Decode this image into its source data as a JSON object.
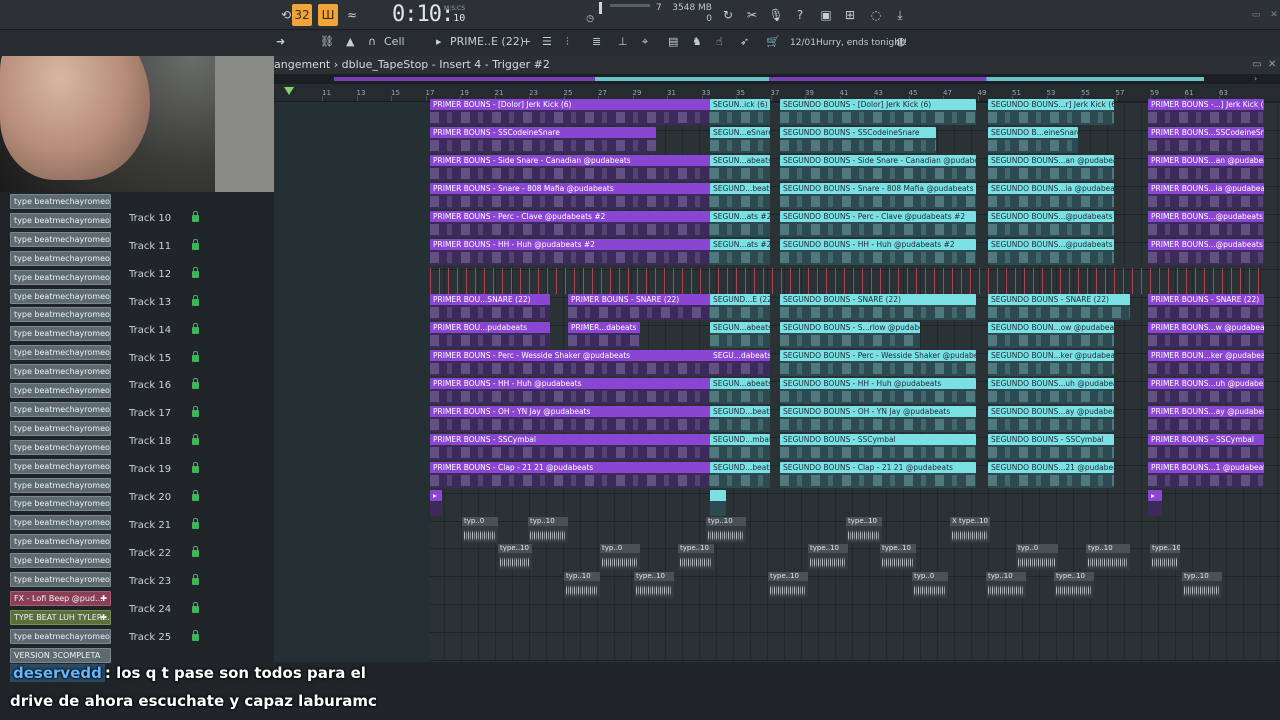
{
  "toolbar": {
    "pattern_btn": "32",
    "song_btn": "Ш",
    "timer_main": "0:10:",
    "timer_sub": "10",
    "timer_unit": "M:S:CS",
    "pitch": "7",
    "mem": "3548 MB",
    "cpu_small": "0"
  },
  "toolbar2": {
    "snap": "Cell",
    "pattern": "PRIME..E (22)",
    "promo_date": "12/01",
    "promo_text": "Hurry, ends tonight!"
  },
  "playlist": {
    "title": "angement › dblue_TapeStop - Insert 4 - Trigger #2",
    "bars": [
      "11",
      "13",
      "15",
      "17",
      "19",
      "21",
      "23",
      "25",
      "27",
      "29",
      "31",
      "33",
      "35",
      "37",
      "39",
      "41",
      "43",
      "45",
      "47",
      "49",
      "51",
      "53",
      "55",
      "57",
      "59",
      "61",
      "63"
    ]
  },
  "channels": [
    "type beatmechayromeo_...",
    "type beatmechayromeo_...",
    "type beatmechayromeo_...",
    "type beatmechayromeo_...",
    "type beatmechayromeo_...",
    "type beatmechayromeo_...",
    "type beatmechayromeo_...",
    "type beatmechayromeo_...",
    "type beatmechayromeo_...",
    "type beatmechayromeo_...",
    "type beatmechayromeo_...",
    "type beatmechayromeo_...",
    "type beatmechayromeo_...",
    "type beatmechayromeo_...",
    "type beatmechayromeo_...",
    "type beatmechayromeo_...",
    "type beatmechayromeo_...",
    "type beatmechayromeo_...",
    "type beatmechayromeo_...",
    "type beatmechayromeo_...",
    "type beatmechayromeo_...",
    "FX - Lofi Beep @pud...",
    "TYPE BEAT LUH TYLER...",
    "type beatmechayromeo_...",
    "VERSION 3COMPLETA"
  ],
  "tracks": [
    "Track 10",
    "Track 11",
    "Track 12",
    "Track 13",
    "Track 14",
    "Track 15",
    "Track 16",
    "Track 17",
    "Track 18",
    "Track 19",
    "Track 20",
    "Track 21",
    "Track 22",
    "Track 23",
    "Track 24",
    "Track 25"
  ],
  "clips": {
    "row0": [
      "PRIMER BOUNS - [Dolor] Jerk Kick (6)",
      "SEGUN..ick (6)",
      "SEGUNDO BOUNS - [Dolor] Jerk Kick (6)",
      "SEGUNDO BOUNS...r] Jerk Kick (6)",
      "PRIMER BOUNS -...] Jerk Kick (6)"
    ],
    "row1": [
      "PRIMER BOUNS - SSCodeineSnare",
      "SEGUN...eSnare",
      "SEGUNDO BOUNS - SSCodeineSnare",
      "SEGUNDO B...eineSnare",
      "PRIMER BOUNS...SSCodeineSnare"
    ],
    "row2": [
      "PRIMER BOUNS - Side Snare - Canadian @pudabeats",
      "SEGUN...abeats",
      "SEGUNDO BOUNS - Side Snare - Canadian @pudabeats",
      "SEGUNDO BOUNS...an @pudabeats",
      "PRIMER BOUNS...an @pudabeats"
    ],
    "row3": [
      "PRIMER BOUNS - Snare - 808 Mafia @pudabeats",
      "SEGUND...beats",
      "SEGUNDO BOUNS - Snare - 808 Mafia @pudabeats",
      "SEGUNDO BOUNS...ia @pudabeats",
      "PRIMER BOUNS...ia @pudabeats"
    ],
    "row4": [
      "PRIMER BOUNS - Perc - Clave @pudabeats #2",
      "SEGUN...ats #2",
      "SEGUNDO BOUNS - Perc - Clave @pudabeats #2",
      "SEGUNDO BOUNS...@pudabeats #2",
      "PRIMER BOUNS...@pudabeats #2"
    ],
    "row5": [
      "PRIMER BOUNS - HH - Huh @pudabeats #2",
      "SEGUN...ats #2",
      "SEGUNDO BOUNS - HH - Huh @pudabeats #2",
      "SEGUNDO BOUNS...@pudabeats #2",
      "PRIMER BOUNS...@pudabeats #2"
    ],
    "row7": [
      "PRIMER BOU...SNARE (22)",
      "PRIMER BOUNS - SNARE (22)",
      "SEGUND...E (22)",
      "SEGUNDO BOUNS - SNARE (22)",
      "SEGUNDO BOUNS - SNARE (22)",
      "PRIMER BOUNS - SNARE (22)"
    ],
    "row8": [
      "PRIMER BOU...pudabeats",
      "PRIMER...dabeats",
      "SEGUN...abeats",
      "SEGUNDO BOUNS - S...rlow @pudabeats",
      "SEGUNDO BOUN...ow @pudabeats",
      "PRIMER BOUNS...w @pudabeats"
    ],
    "row9": [
      "PRIMER BOUNS - Perc - Wesside Shaker @pudabeats",
      "SEGU...dabeats",
      "SEGUNDO BOUNS - Perc - Wesside Shaker @pudabeats",
      "SEGUNDO BOUN...ker @pudabeats",
      "PRIMER BOUN...ker @pudabeats"
    ],
    "row10": [
      "PRIMER BOUNS - HH - Huh @pudabeats",
      "SEGUN...abeats",
      "SEGUNDO BOUNS - HH - Huh @pudabeats",
      "SEGUNDO BOUNS...uh @pudabeats",
      "PRIMER BOUNS...uh @pudabeats"
    ],
    "row11": [
      "PRIMER BOUNS - OH - YN Jay @pudabeats",
      "SEGUND...beats",
      "SEGUNDO BOUNS - OH - YN Jay @pudabeats",
      "SEGUNDO BOUNS...ay @pudabeats",
      "PRIMER BOUNS...ay @pudabeats"
    ],
    "row12": [
      "PRIMER BOUNS - SSCymbal",
      "SEGUND...mbal",
      "SEGUNDO BOUNS - SSCymbal",
      "SEGUNDO BOUNS - SSCymbal",
      "PRIMER BOUNS - SSCymbal"
    ],
    "row13": [
      "PRIMER BOUNS - Clap - 21 21 @pudabeats",
      "SEGUND...beats",
      "SEGUNDO BOUNS - Clap - 21 21 @pudabeats",
      "SEGUNDO BOUNS...21 @pudabeats",
      "PRIMER BOUNS...1 @pudabeats"
    ],
    "audio": [
      "typ..0",
      "typ..10",
      "typ..10",
      "type..10",
      "X type..10",
      "type..10",
      "typ..0",
      "type..10",
      "type..10",
      "type..10",
      "typ..0",
      "typ..10",
      "type..10",
      "typ..10"
    ]
  },
  "chat": {
    "user": "deservedd",
    "line1": ": los q t pase son todos para el",
    "line2": "drive de ahora escuchate y capaz laburamc"
  },
  "colors": {
    "purple": "#8a45d2",
    "teal": "#7ae0e4",
    "accent": "#f0a43a"
  }
}
